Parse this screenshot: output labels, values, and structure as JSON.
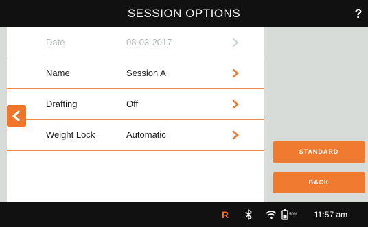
{
  "title_bar": {
    "title": "SESSION OPTIONS",
    "help_label": "?"
  },
  "rows": [
    {
      "label": "Date",
      "value": "08-03-2017",
      "state": "disabled"
    },
    {
      "label": "Name",
      "value": "Session A",
      "state": "enabled"
    },
    {
      "label": "Drafting",
      "value": "Off",
      "state": "enabled"
    },
    {
      "label": "Weight Lock",
      "value": "Automatic",
      "state": "enabled"
    }
  ],
  "buttons": {
    "top_label": "STANDARD",
    "bottom_label": "BACK"
  },
  "status_bar": {
    "record_indicator": "R",
    "battery_percent": "50%",
    "time": "11:57 am",
    "icons": [
      "bluetooth-icon",
      "wifi-icon",
      "battery-icon"
    ]
  },
  "colors": {
    "accent": "#f07a30",
    "bar_background": "#111111",
    "panel_background": "#d7dcd8",
    "list_background": "#ffffff",
    "divider": "#f08a4b"
  }
}
